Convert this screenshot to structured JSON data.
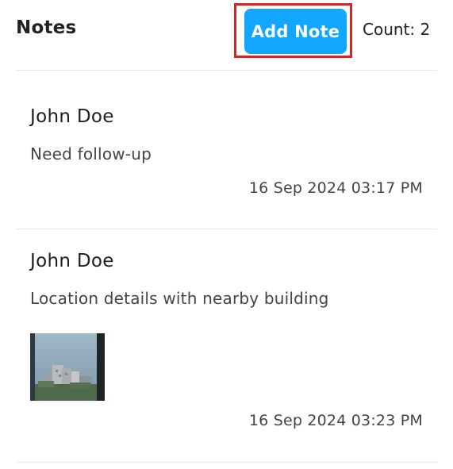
{
  "header": {
    "title": "Notes",
    "add_button_label": "Add Note",
    "count_label": "Count: 2",
    "highlight_color": "#e02020",
    "button_color": "#12a6ff"
  },
  "notes": [
    {
      "author": "John Doe",
      "text": "Need follow-up",
      "date": "16 Sep 2024 03:17 PM",
      "has_image": false
    },
    {
      "author": "John Doe",
      "text": "Location details with nearby building",
      "date": "16 Sep 2024 03:23 PM",
      "has_image": true,
      "image_icon": "photo-thumbnail"
    }
  ]
}
